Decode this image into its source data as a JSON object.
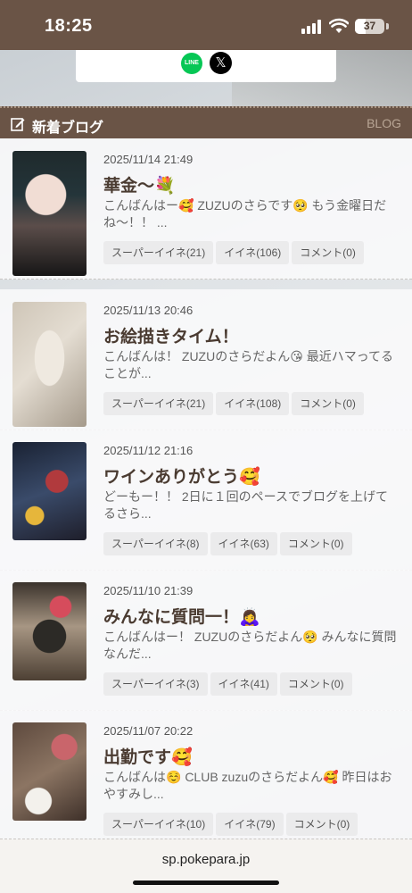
{
  "status": {
    "time": "18:25",
    "battery": "37",
    "battery_level": 0.37
  },
  "share": {
    "line_label": "LINE",
    "x_label": "𝕏"
  },
  "section": {
    "title": "新着ブログ",
    "tag": "BLOG"
  },
  "posts": [
    {
      "date": "2025/11/14 21:49",
      "title": "華金〜💐",
      "excerpt": "こんばんはー🥰 ZUZUのさらです🥺 もう金曜日だね〜！！ ...",
      "super_like": "スーパーイイネ(21)",
      "like": "イイネ(106)",
      "comment": "コメント(0)"
    },
    {
      "date": "2025/11/13 20:46",
      "title": "お絵描きタイム！",
      "excerpt": "こんばんは！ ZUZUのさらだよん😘 最近ハマってることが...",
      "super_like": "スーパーイイネ(21)",
      "like": "イイネ(108)",
      "comment": "コメント(0)"
    },
    {
      "date": "2025/11/12 21:16",
      "title": "ワインありがとう🥰",
      "excerpt": "どーもー！！ 2日に１回のペースでブログを上げてるさら...",
      "super_like": "スーパーイイネ(8)",
      "like": "イイネ(63)",
      "comment": "コメント(0)"
    },
    {
      "date": "2025/11/10 21:39",
      "title": "みんなに質問一！🙇‍♀️",
      "excerpt": "こんばんはー！ ZUZUのさらだよん🥺 みんなに質問なんだ...",
      "super_like": "スーパーイイネ(3)",
      "like": "イイネ(41)",
      "comment": "コメント(0)"
    },
    {
      "date": "2025/11/07 20:22",
      "title": "出勤です🥰",
      "excerpt": "こんばんは☺️ CLUB zuzuのさらだよん🥰 昨日はおやすみし...",
      "super_like": "スーパーイイネ(10)",
      "like": "イイネ(79)",
      "comment": "コメント(0)"
    }
  ],
  "browser": {
    "url": "sp.pokepara.jp"
  }
}
